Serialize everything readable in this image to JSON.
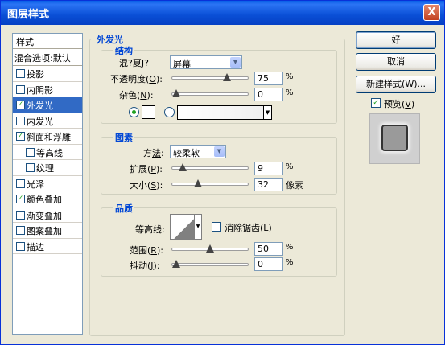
{
  "window": {
    "title": "图层样式",
    "close_glyph": "X"
  },
  "styles_panel": {
    "header": "样式",
    "blending_options": "混合选项:默认",
    "items": [
      {
        "label": "投影",
        "checked": false,
        "indent": false,
        "selected": false
      },
      {
        "label": "内阴影",
        "checked": false,
        "indent": false,
        "selected": false
      },
      {
        "label": "外发光",
        "checked": true,
        "indent": false,
        "selected": true
      },
      {
        "label": "内发光",
        "checked": false,
        "indent": false,
        "selected": false
      },
      {
        "label": "斜面和浮雕",
        "checked": true,
        "indent": false,
        "selected": false
      },
      {
        "label": "等高线",
        "checked": false,
        "indent": true,
        "selected": false
      },
      {
        "label": "纹理",
        "checked": false,
        "indent": true,
        "selected": false
      },
      {
        "label": "光泽",
        "checked": false,
        "indent": false,
        "selected": false
      },
      {
        "label": "颜色叠加",
        "checked": true,
        "indent": false,
        "selected": false
      },
      {
        "label": "渐变叠加",
        "checked": false,
        "indent": false,
        "selected": false
      },
      {
        "label": "图案叠加",
        "checked": false,
        "indent": false,
        "selected": false
      },
      {
        "label": "描边",
        "checked": false,
        "indent": false,
        "selected": false
      }
    ]
  },
  "outer_glow": {
    "title": "外发光",
    "structure": {
      "title": "结构",
      "blend_mode_label": "混?夏J?",
      "blend_mode_value": "屏幕",
      "opacity_label_pre": "不透明度(",
      "opacity_key": "O",
      "opacity_label_post": "):",
      "opacity_value": "75",
      "opacity_unit": "%",
      "opacity_level": 75,
      "noise_label_pre": "杂色(",
      "noise_key": "N",
      "noise_label_post": "):",
      "noise_value": "0",
      "noise_unit": "%",
      "noise_level": 0,
      "color_mode": "solid",
      "swatch_color": "#ffffff"
    },
    "elements": {
      "title": "图素",
      "technique_label_pre": "方",
      "technique_key": "法",
      "technique_label_post": ":",
      "technique_value": "较柔软",
      "spread_label_pre": "扩展(",
      "spread_key": "P",
      "spread_label_post": "):",
      "spread_value": "9",
      "spread_unit": "%",
      "spread_level": 9,
      "size_label_pre": "大小(",
      "size_key": "S",
      "size_label_post": "):",
      "size_value": "32",
      "size_unit": "像素",
      "size_level": 32
    },
    "quality": {
      "title": "品质",
      "contour_label": "等高线:",
      "anti_alias_label_pre": "消除锯齿(",
      "anti_alias_key": "L",
      "anti_alias_label_post": ")",
      "anti_alias_checked": false,
      "range_label_pre": "范围(",
      "range_key": "R",
      "range_label_post": "):",
      "range_value": "50",
      "range_unit": "%",
      "range_level": 50,
      "jitter_label_pre": "抖动(",
      "jitter_key": "J",
      "jitter_label_post": "):",
      "jitter_value": "0",
      "jitter_unit": "%",
      "jitter_level": 0
    }
  },
  "buttons": {
    "ok": "好",
    "cancel": "取消",
    "new_style_pre": "新建样式(",
    "new_style_key": "W",
    "new_style_post": ")...",
    "preview_pre": "预览(",
    "preview_key": "V",
    "preview_post": ")",
    "preview_checked": true
  },
  "colors": {
    "titlebar": "#0a4fd6",
    "selection": "#316ac5",
    "legend": "#0046d5",
    "check": "#21a121"
  }
}
